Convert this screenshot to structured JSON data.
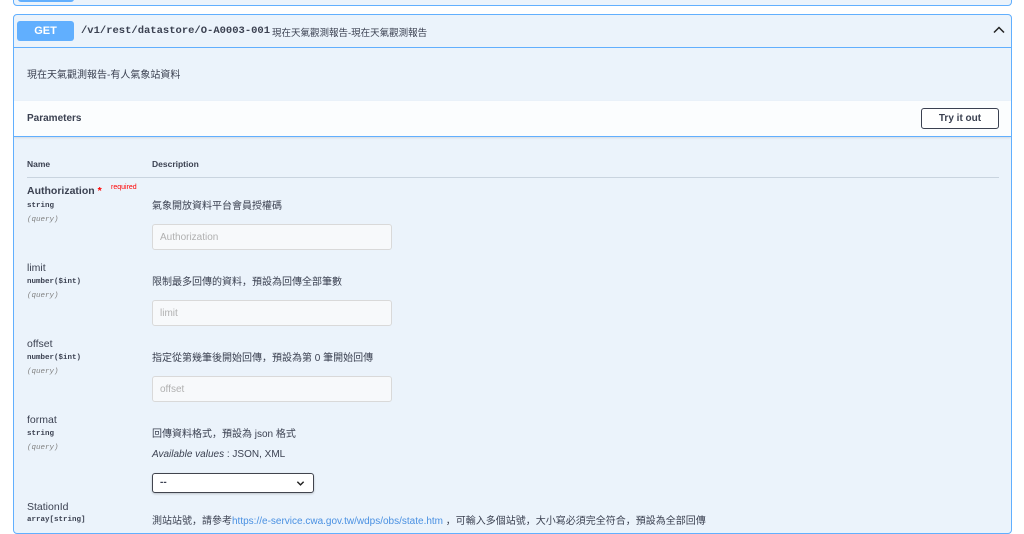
{
  "operation": {
    "method": "GET",
    "path": "/v1/rest/datastore/O-A0003-001",
    "summary": "現在天氣觀測報告-現在天氣觀測報告",
    "description": "現在天氣觀測報告-有人氣象站資料",
    "accent_color": "#61affe",
    "collapse_icon": "chevron-up-icon"
  },
  "parameters": {
    "title": "Parameters",
    "try_it_out_label": "Try it out",
    "col_name": "Name",
    "col_description": "Description",
    "items": [
      {
        "name": "Authorization",
        "required_star": "*",
        "required_label": "required",
        "type": "string",
        "in": "(query)",
        "description": "氣象開放資料平台會員授權碼",
        "placeholder": "Authorization"
      },
      {
        "name": "limit",
        "type": "number($int)",
        "in": "(query)",
        "description": "限制最多回傳的資料，預設為回傳全部筆數",
        "placeholder": "limit"
      },
      {
        "name": "offset",
        "type": "number($int)",
        "in": "(query)",
        "description": "指定從第幾筆後開始回傳，預設為第 0 筆開始回傳",
        "placeholder": "offset"
      },
      {
        "name": "format",
        "type": "string",
        "in": "(query)",
        "description": "回傳資料格式，預設為 json 格式",
        "available_label": "Available values",
        "available_values": " : JSON, XML",
        "selected": "--"
      },
      {
        "name": "StationId",
        "type": "array[string]",
        "description_prefix": "測站站號，請參考",
        "description_link": "https://e-service.cwa.gov.tw/wdps/obs/state.htm",
        "description_suffix": " ，可輸入多個站號，大小寫必須完全符合，預設為全部回傳"
      }
    ]
  }
}
